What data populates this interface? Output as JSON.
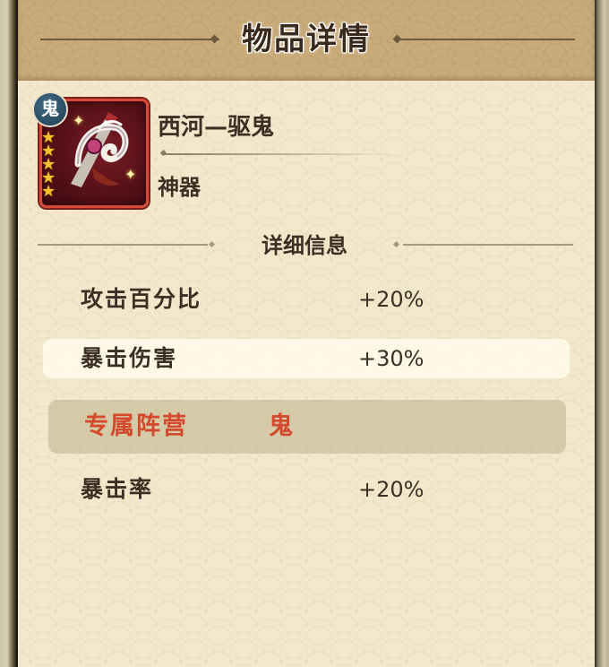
{
  "dialog": {
    "title": "物品详情"
  },
  "item": {
    "name": "西河—驱鬼",
    "type": "神器",
    "badge": "鬼",
    "stars": 5,
    "icon": "fan-weapon-icon",
    "frame_color": "#d64a3a"
  },
  "details": {
    "section_title": "详细信息",
    "stats": [
      {
        "label": "攻击百分比",
        "value": "+20%"
      },
      {
        "label": "暴击伤害",
        "value": "+30%"
      }
    ],
    "exclusive": {
      "label": "专属阵营",
      "value": "鬼",
      "color": "#d4482c"
    },
    "exclusive_stats": [
      {
        "label": "暴击率",
        "value": "+20%"
      }
    ]
  }
}
